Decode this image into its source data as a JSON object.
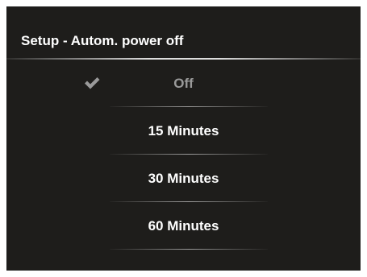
{
  "screen": {
    "title": "Setup - Autom. power off"
  },
  "menu": {
    "items": [
      {
        "label": "Off",
        "selected": true,
        "icon": "checkmark-icon"
      },
      {
        "label": "15 Minutes",
        "selected": false
      },
      {
        "label": "30 Minutes",
        "selected": false
      },
      {
        "label": "60 Minutes",
        "selected": false
      }
    ]
  },
  "colors": {
    "background": "#1e1d1b",
    "text": "#ffffff",
    "selected_text": "#9a9a9a",
    "checkmark": "#9a9a9a"
  }
}
